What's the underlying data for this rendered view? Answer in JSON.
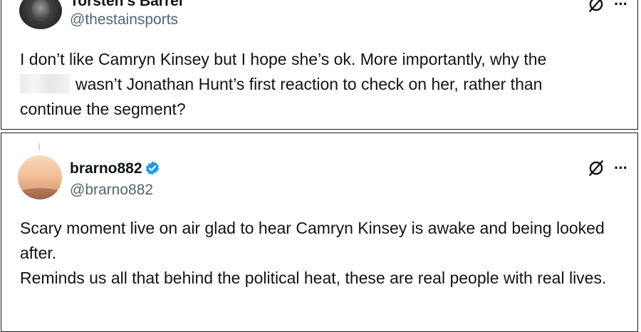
{
  "tweets": [
    {
      "display_name": "Torsten's Barrel",
      "handle": "@thestainsports",
      "verified": false,
      "avatar_icon": "user-avatar-photo",
      "body_line_1": "I don’t like Camryn Kinsey but I hope she’s ok. More importantly, why the",
      "body_line_2": "wasn’t Jonathan Hunt’s first reaction to check on her, rather than",
      "body_line_3": "continue the segment?",
      "redacted": true
    },
    {
      "display_name": "brarno882",
      "handle": "@brarno882",
      "verified": true,
      "avatar_icon": "sunset-avatar-photo",
      "body_para_1": "Scary moment live on air glad to hear Camryn Kinsey is awake and being looked after.",
      "body_para_2": "Reminds us all that behind the political heat, these are real people with real lives."
    }
  ],
  "icons": {
    "grok": "grok-icon",
    "more": "more-options-icon",
    "verified": "verified-badge-icon"
  },
  "colors": {
    "text": "#0f1419",
    "secondary": "#536471",
    "verified_blue": "#1d9bf0",
    "border": "#1c1c1c"
  },
  "more_glyph": "···"
}
